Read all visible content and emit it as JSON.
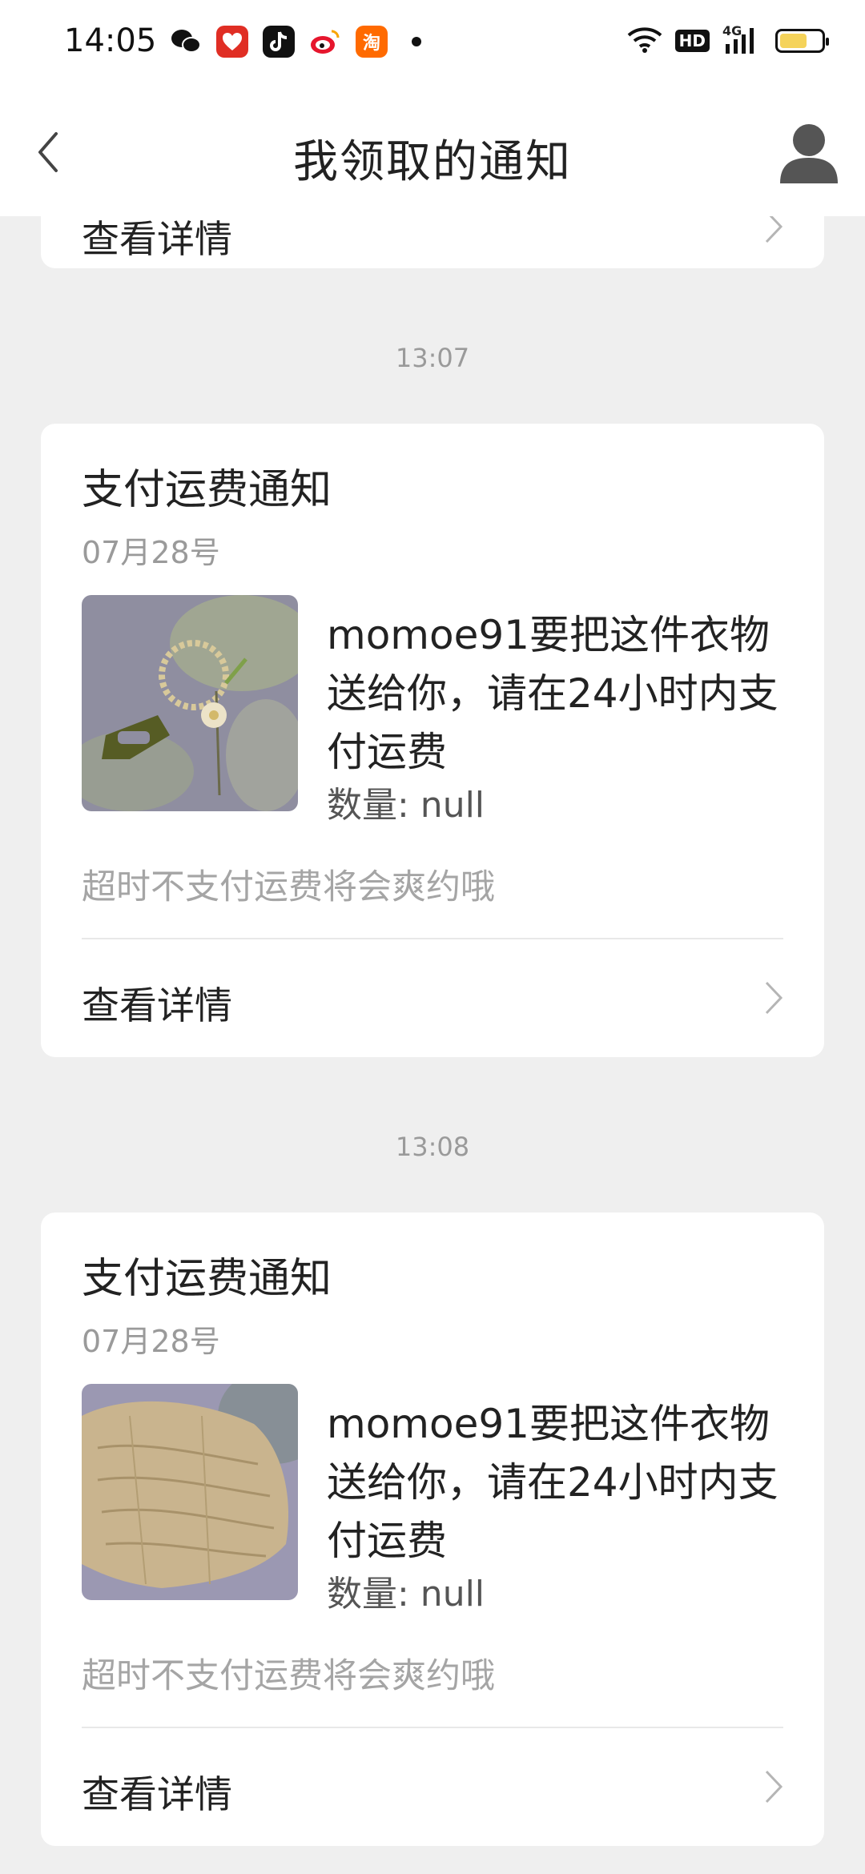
{
  "status_bar": {
    "time": "14:05",
    "app_icons": [
      "wechat-icon",
      "pinduoduo-icon",
      "tiktok-icon",
      "weibo-icon",
      "taobao-icon"
    ],
    "taobao_char": "淘",
    "network": "4G",
    "hd": "HD",
    "battery_level": 0.65
  },
  "header": {
    "title": "我领取的通知"
  },
  "partial_card": {
    "detail_label": "查看详情"
  },
  "notifications": [
    {
      "time": "13:07",
      "title": "支付运费通知",
      "date": "07月28号",
      "message": "momoe91要把这件衣物送给你，请在24小时内支付运费",
      "quantity_label": "数量: null",
      "warning": "超时不支付运费将会爽约哦",
      "detail_label": "查看详情"
    },
    {
      "time": "13:08",
      "title": "支付运费通知",
      "date": "07月28号",
      "message": "momoe91要把这件衣物送给你，请在24小时内支付运费",
      "quantity_label": "数量: null",
      "warning": "超时不支付运费将会爽约哦",
      "detail_label": "查看详情"
    }
  ],
  "colors": {
    "background": "#efefef",
    "card": "#ffffff",
    "muted_text": "#9a9a9a",
    "battery": "#f5d35a"
  }
}
